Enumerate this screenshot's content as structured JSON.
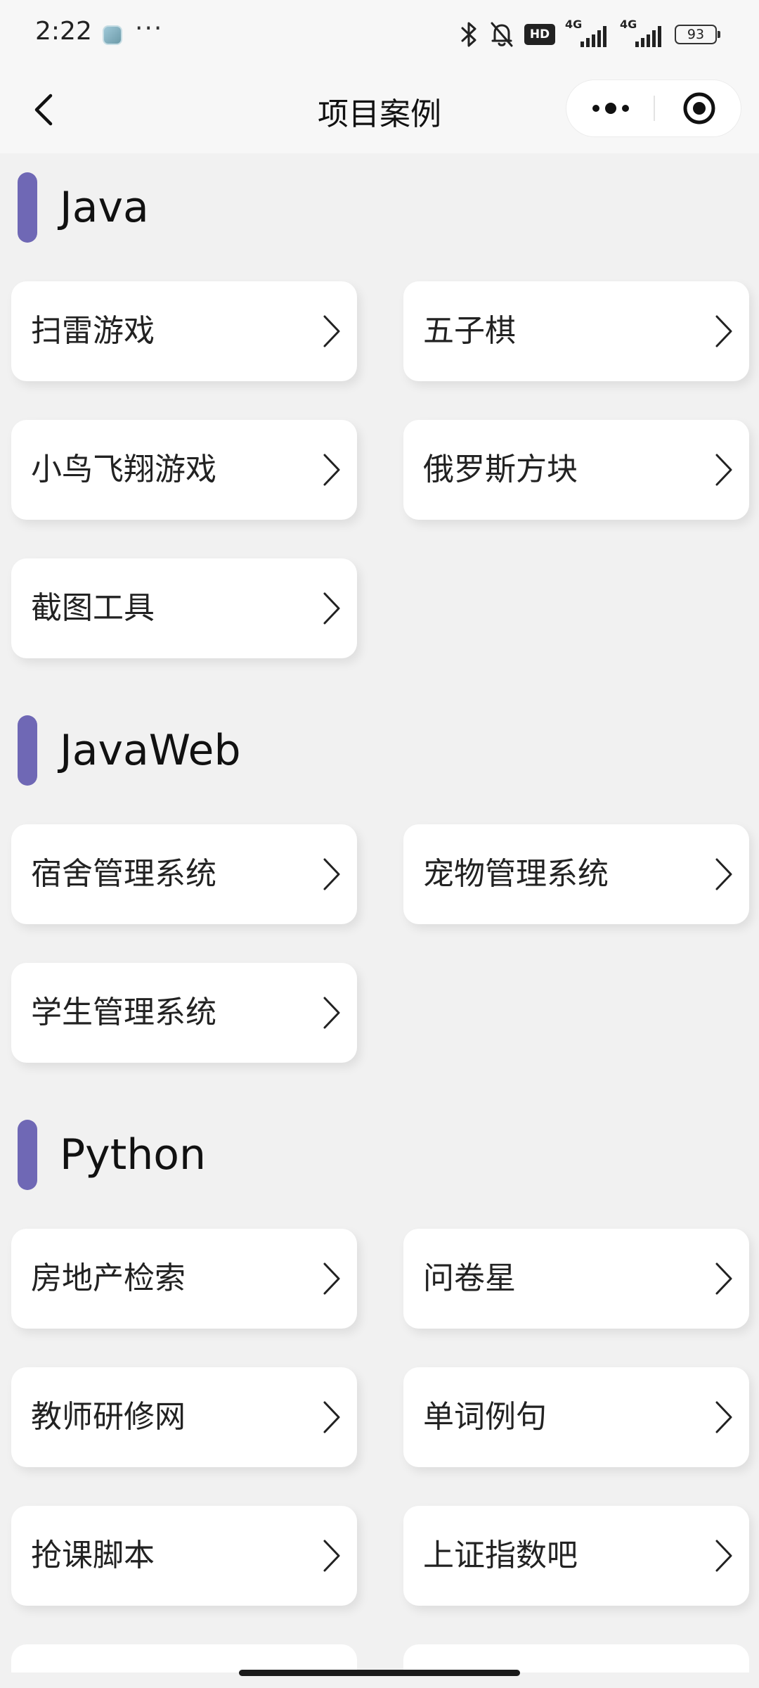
{
  "status_bar": {
    "time": "2:22",
    "more": "···",
    "hd_label": "HD",
    "signal_1_label": "4G",
    "signal_2_label": "4G",
    "battery": "93"
  },
  "nav": {
    "title": "项目案例"
  },
  "sections": [
    {
      "title": "Java",
      "items": [
        "扫雷游戏",
        "五子棋",
        "小鸟飞翔游戏",
        "俄罗斯方块",
        "截图工具"
      ]
    },
    {
      "title": "JavaWeb",
      "items": [
        "宿舍管理系统",
        "宠物管理系统",
        "学生管理系统"
      ]
    },
    {
      "title": "Python",
      "items": [
        "房地产检索",
        "问卷星",
        "教师研修网",
        "单词例句",
        "抢课脚本",
        "上证指数吧"
      ]
    }
  ],
  "colors": {
    "accent": "#6f68b5",
    "background": "#f1f1f1",
    "card": "#ffffff"
  },
  "icons": {
    "back": "chevron-left-icon",
    "capsule_more": "more-dots-icon",
    "capsule_close": "target-circle-icon",
    "card_arrow": "chevron-right-icon"
  }
}
